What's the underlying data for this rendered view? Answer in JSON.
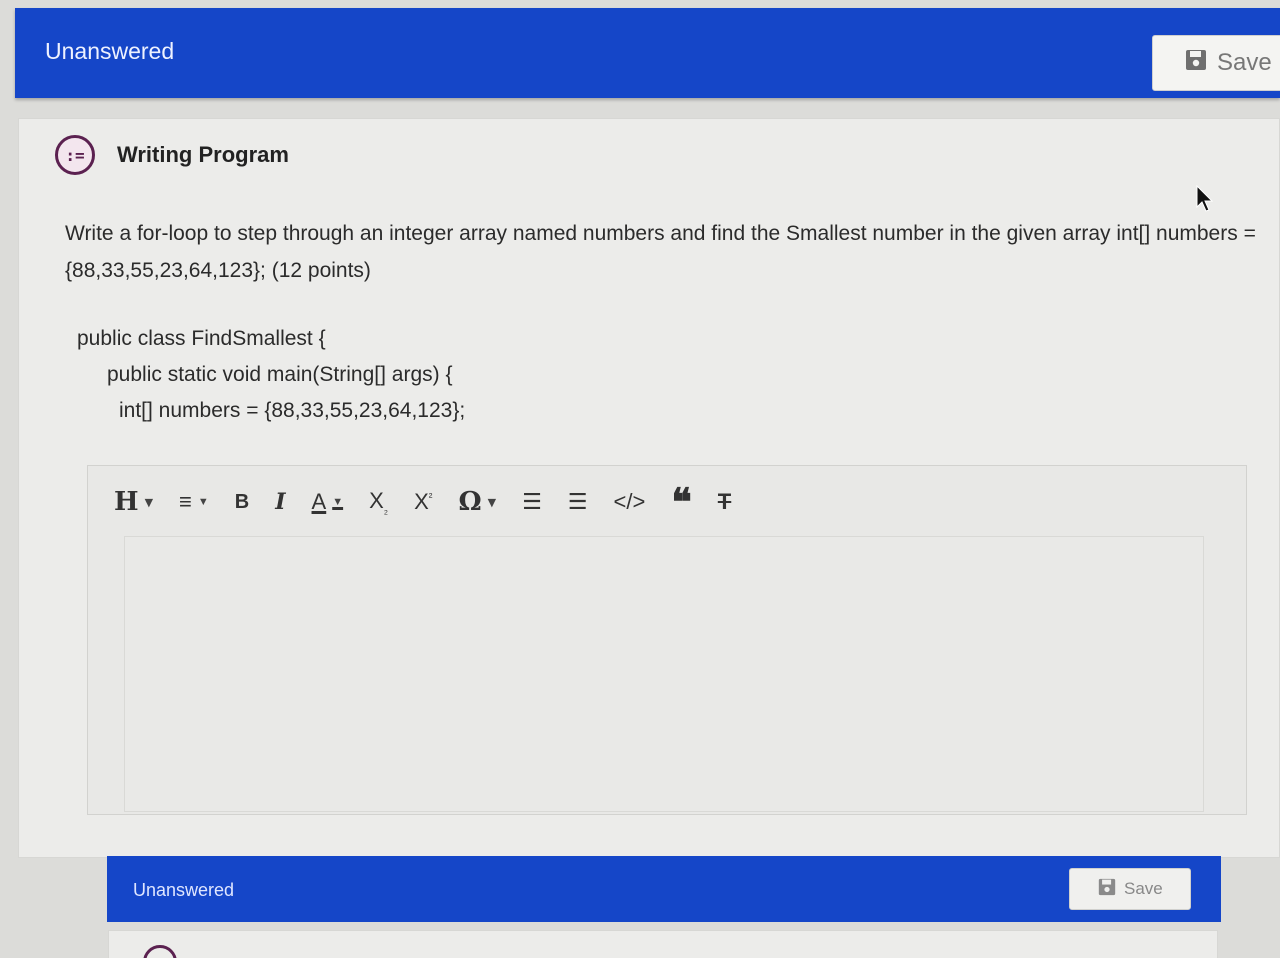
{
  "top_bar": {
    "status": "Unanswered",
    "save_label": "Save",
    "save_icon": "floppy-disk-icon"
  },
  "question": {
    "icon": "list-bubble-icon",
    "icon_glyph": ":=",
    "title": "Writing Program",
    "prompt_line1": "Write a for-loop to step through an integer array named numbers and find the Smallest number in the given array  int[] numbers =",
    "prompt_line2": "{88,33,55,23,64,123};  (12 points)",
    "code": [
      "public class FindSmallest {",
      "public static void main(String[] args) {",
      "int[] numbers = {88,33,55,23,64,123};"
    ]
  },
  "editor": {
    "toolbar": {
      "heading": "H",
      "align": "≡",
      "bold": "B",
      "italic": "I",
      "font_color": "A",
      "subscript": "X",
      "subscript_sub": "₂",
      "superscript": "X",
      "superscript_sup": "²",
      "special_char": "Ω",
      "bullet_list": "☰",
      "numbered_list": "☰",
      "code": "</>",
      "quote": "❝",
      "clear_format": "T"
    },
    "value": ""
  },
  "bottom_bar": {
    "status": "Unanswered",
    "save_label": "Save",
    "save_icon": "floppy-disk-icon"
  },
  "colors": {
    "bar_blue": "#1546c8",
    "icon_purple": "#5b2150"
  }
}
